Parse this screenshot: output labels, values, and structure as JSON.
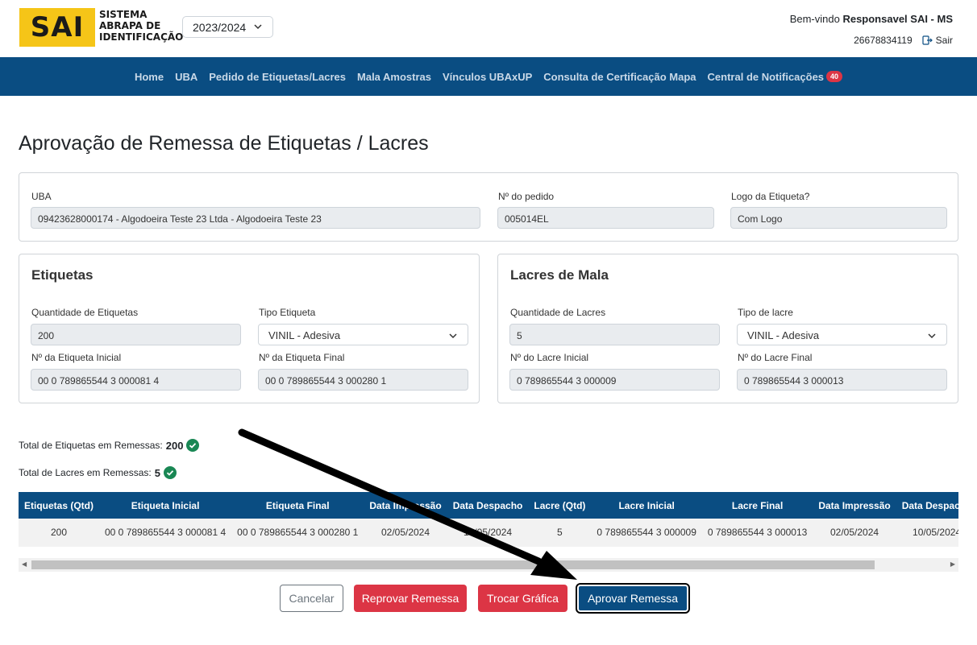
{
  "header": {
    "logo_text": "SAI",
    "logo_subtitle": [
      "SISTEMA",
      "ABRAPA DE",
      "IDENTIFICAÇÃO"
    ],
    "year": "2023/2024",
    "welcome_prefix": "Bem-vindo",
    "user_name": "Responsavel SAI - MS",
    "user_id": "26678834119",
    "logout_label": "Sair"
  },
  "nav": {
    "items": [
      {
        "label": "Home"
      },
      {
        "label": "UBA"
      },
      {
        "label": "Pedido de Etiquetas/Lacres"
      },
      {
        "label": "Mala Amostras"
      },
      {
        "label": "Vínculos UBAxUP"
      },
      {
        "label": "Consulta de Certificação Mapa"
      },
      {
        "label": "Central de Notificações"
      }
    ],
    "notification_count": "40"
  },
  "page_title": "Aprovação de Remessa de Etiquetas / Lacres",
  "order": {
    "uba_label": "UBA",
    "uba_value": "09423628000174 - Algodoeira Teste 23 Ltda - Algodoeira Teste 23",
    "pedido_label": "Nº do pedido",
    "pedido_value": "005014EL",
    "logo_label": "Logo da Etiqueta?",
    "logo_value": "Com Logo"
  },
  "etiquetas": {
    "title": "Etiquetas",
    "qtd_label": "Quantidade de Etiquetas",
    "qtd_value": "200",
    "tipo_label": "Tipo Etiqueta",
    "tipo_value": "VINIL - Adesiva",
    "inicial_label": "Nº da Etiqueta Inicial",
    "inicial_value": "00 0 789865544 3 000081 4",
    "final_label": "Nº da Etiqueta Final",
    "final_value": "00 0 789865544 3 000280 1"
  },
  "lacres": {
    "title": "Lacres de Mala",
    "qtd_label": "Quantidade de Lacres",
    "qtd_value": "5",
    "tipo_label": "Tipo de lacre",
    "tipo_value": "VINIL - Adesiva",
    "inicial_label": "Nº do Lacre Inicial",
    "inicial_value": "0 789865544 3 000009",
    "final_label": "Nº do Lacre Final",
    "final_value": "0 789865544 3 000013"
  },
  "totals": {
    "etiquetas_label": "Total de Etiquetas em Remessas:",
    "etiquetas_value": "200",
    "lacres_label": "Total de Lacres em Remessas:",
    "lacres_value": "5"
  },
  "table": {
    "headers": [
      "Etiquetas (Qtd)",
      "Etiqueta Inicial",
      "Etiqueta Final",
      "Data Impressão",
      "Data Despacho",
      "Lacre (Qtd)",
      "Lacre Inicial",
      "Lacre Final",
      "Data Impressão",
      "Data Despacho"
    ],
    "rows": [
      [
        "200",
        "00 0 789865544 3 000081 4",
        "00 0 789865544 3 000280 1",
        "02/05/2024",
        "10/05/2024",
        "5",
        "0 789865544 3 000009",
        "0 789865544 3 000013",
        "02/05/2024",
        "10/05/2024"
      ]
    ]
  },
  "buttons": {
    "cancel": "Cancelar",
    "reject": "Reprovar Remessa",
    "change": "Trocar Gráfica",
    "approve": "Aprovar Remessa"
  },
  "colors": {
    "primary": "#0a4d82",
    "danger": "#dc3545",
    "success": "#198754",
    "logo": "#f5c518"
  }
}
